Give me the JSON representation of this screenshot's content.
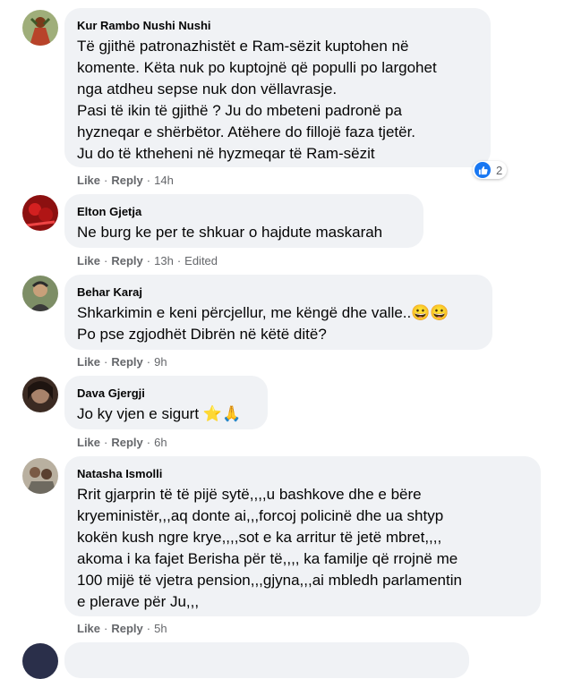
{
  "comments": [
    {
      "author": "Kur Rambo Nushi Nushi",
      "lines": [
        "Të gjithë patronazhistët e Ram-sëzit kuptohen në",
        "komente. Këta nuk po kuptojnë që populli po largohet",
        "nga atdheu sepse nuk don vëllavrasje.",
        "Pasi të ikin të gjithë ? Ju do mbeteni padronë pa",
        "hyzneqar e shërbëtor. Atëhere do fillojë faza tjetër.",
        "Ju do të ktheheni në hyzmeqar të Ram-sëzit"
      ],
      "like": "Like",
      "reply": "Reply",
      "time": "14h",
      "reaction_count": "2"
    },
    {
      "author": "Elton Gjetja",
      "lines": [
        "Ne burg ke per te shkuar o hajdute maskarah"
      ],
      "like": "Like",
      "reply": "Reply",
      "time": "13h",
      "edited": "Edited"
    },
    {
      "author": "Behar Karaj",
      "lines": [
        "Shkarkimin e keni përcjellur, me këngë dhe valle..😀😀",
        "Po pse zgjodhët Dibrën në këtë ditë?"
      ],
      "like": "Like",
      "reply": "Reply",
      "time": "9h"
    },
    {
      "author": "Dava Gjergji",
      "lines": [
        "Jo ky vjen e sigurt ⭐🙏"
      ],
      "like": "Like",
      "reply": "Reply",
      "time": "6h"
    },
    {
      "author": "Natasha Ismolli",
      "lines": [
        "Rrit gjarprin të të pijë sytë,,,,u bashkove dhe e bëre",
        "kryeministër,,,aq donte ai,,,forcoj policinë dhe ua shtyp",
        "kokën kush ngre krye,,,,sot e ka arritur të jetë mbret,,,,",
        "akoma i ka fajet Berisha për të,,,, ka familje që rrojnë me",
        "100 mijë të vjetra pension,,,gjyna,,,ai mbledh parlamentin",
        "e plerave për Ju,,,"
      ],
      "like": "Like",
      "reply": "Reply",
      "time": "5h"
    }
  ],
  "icons": {
    "like_reaction": "thumbs-up-icon"
  },
  "colors": {
    "bubble": "#f0f2f5",
    "meta": "#65676b",
    "like_blue": "#1877f2"
  }
}
